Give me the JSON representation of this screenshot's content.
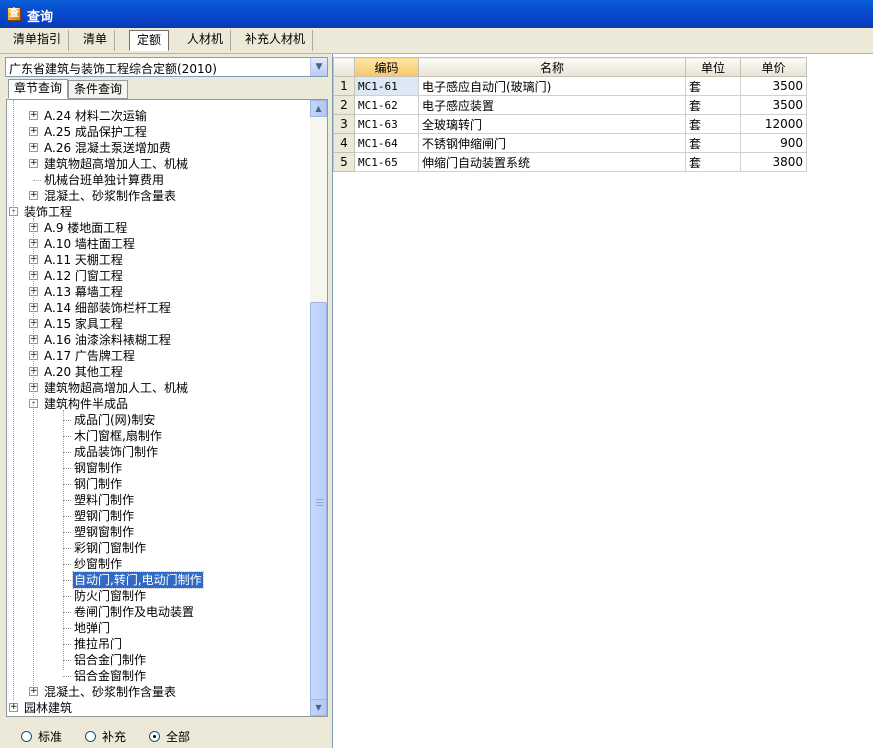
{
  "window": {
    "title": "查询",
    "icon": "app-icon"
  },
  "top_tabs": [
    {
      "label": "清单指引",
      "active": false
    },
    {
      "label": "清单",
      "active": false
    },
    {
      "label": "定额",
      "active": true
    },
    {
      "label": "人材机",
      "active": false
    },
    {
      "label": "补充人材机",
      "active": false
    }
  ],
  "quota_library": {
    "selected": "广东省建筑与装饰工程综合定额(2010)"
  },
  "sub_tabs": [
    {
      "label": "章节查询",
      "active": true
    },
    {
      "label": "条件查询",
      "active": false
    }
  ],
  "tree": {
    "items": [
      {
        "label": "A.24 材料二次运输",
        "level": 1,
        "toggle": "+"
      },
      {
        "label": "A.25 成品保护工程",
        "level": 1,
        "toggle": "+"
      },
      {
        "label": "A.26 混凝土泵送增加费",
        "level": 1,
        "toggle": "+"
      },
      {
        "label": "建筑物超高增加人工、机械",
        "level": 1,
        "toggle": "+"
      },
      {
        "label": "机械台班单独计算费用",
        "level": 1,
        "toggle": ""
      },
      {
        "label": "混凝土、砂浆制作含量表",
        "level": 1,
        "toggle": "+"
      },
      {
        "label": "装饰工程",
        "level": 0,
        "toggle": "-"
      },
      {
        "label": "A.9 楼地面工程",
        "level": 1,
        "toggle": "+"
      },
      {
        "label": "A.10 墙柱面工程",
        "level": 1,
        "toggle": "+"
      },
      {
        "label": "A.11 天棚工程",
        "level": 1,
        "toggle": "+"
      },
      {
        "label": "A.12 门窗工程",
        "level": 1,
        "toggle": "+"
      },
      {
        "label": "A.13 幕墙工程",
        "level": 1,
        "toggle": "+"
      },
      {
        "label": "A.14 细部装饰栏杆工程",
        "level": 1,
        "toggle": "+"
      },
      {
        "label": "A.15 家具工程",
        "level": 1,
        "toggle": "+"
      },
      {
        "label": "A.16 油漆涂料裱糊工程",
        "level": 1,
        "toggle": "+"
      },
      {
        "label": "A.17 广告牌工程",
        "level": 1,
        "toggle": "+"
      },
      {
        "label": "A.20 其他工程",
        "level": 1,
        "toggle": "+"
      },
      {
        "label": "建筑物超高增加人工、机械",
        "level": 1,
        "toggle": "+"
      },
      {
        "label": "建筑构件半成品",
        "level": 1,
        "toggle": "-"
      },
      {
        "label": "成品门(网)制安",
        "level": 2,
        "toggle": ""
      },
      {
        "label": "木门窗框,扇制作",
        "level": 2,
        "toggle": ""
      },
      {
        "label": "成品装饰门制作",
        "level": 2,
        "toggle": ""
      },
      {
        "label": "钢窗制作",
        "level": 2,
        "toggle": ""
      },
      {
        "label": "钢门制作",
        "level": 2,
        "toggle": ""
      },
      {
        "label": "塑料门制作",
        "level": 2,
        "toggle": ""
      },
      {
        "label": "塑钢门制作",
        "level": 2,
        "toggle": ""
      },
      {
        "label": "塑钢窗制作",
        "level": 2,
        "toggle": ""
      },
      {
        "label": "彩钢门窗制作",
        "level": 2,
        "toggle": ""
      },
      {
        "label": "纱窗制作",
        "level": 2,
        "toggle": ""
      },
      {
        "label": "自动门,转门,电动门制作",
        "level": 2,
        "toggle": "",
        "selected": true
      },
      {
        "label": "防火门窗制作",
        "level": 2,
        "toggle": ""
      },
      {
        "label": "卷闸门制作及电动装置",
        "level": 2,
        "toggle": ""
      },
      {
        "label": "地弹门",
        "level": 2,
        "toggle": ""
      },
      {
        "label": "推拉吊门",
        "level": 2,
        "toggle": ""
      },
      {
        "label": "铝合金门制作",
        "level": 2,
        "toggle": ""
      },
      {
        "label": "铝合金窗制作",
        "level": 2,
        "toggle": ""
      },
      {
        "label": "混凝土、砂浆制作含量表",
        "level": 1,
        "toggle": "+"
      },
      {
        "label": "园林建筑",
        "level": 0,
        "toggle": "+"
      }
    ]
  },
  "filter_radios": [
    {
      "label": "标准",
      "checked": false
    },
    {
      "label": "补充",
      "checked": false
    },
    {
      "label": "全部",
      "checked": true
    }
  ],
  "table": {
    "columns": [
      "编码",
      "名称",
      "单位",
      "单价"
    ],
    "rows": [
      {
        "no": "1",
        "code": "MC1-61",
        "name": "电子感应自动门(玻璃门)",
        "unit": "套",
        "price": "3500"
      },
      {
        "no": "2",
        "code": "MC1-62",
        "name": "电子感应装置",
        "unit": "套",
        "price": "3500"
      },
      {
        "no": "3",
        "code": "MC1-63",
        "name": "全玻璃转门",
        "unit": "套",
        "price": "12000"
      },
      {
        "no": "4",
        "code": "MC1-64",
        "name": "不锈钢伸缩闸门",
        "unit": "套",
        "price": "900"
      },
      {
        "no": "5",
        "code": "MC1-65",
        "name": "伸缩门自动装置系统",
        "unit": "套",
        "price": "3800"
      }
    ]
  },
  "colors": {
    "titlebar": "#0a4fd0",
    "selection": "#316ac5",
    "header_highlight": "#f6c76a"
  }
}
